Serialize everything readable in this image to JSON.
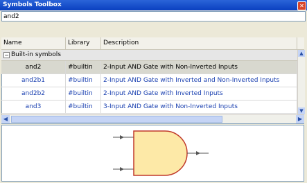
{
  "window": {
    "title": "Symbols Toolbox"
  },
  "search": {
    "value": "and2"
  },
  "table": {
    "headers": [
      "Name",
      "Library",
      "Description"
    ],
    "group": {
      "label": "Built-in symbols",
      "toggle": "−"
    },
    "rows": [
      {
        "name": "and2",
        "library": "#builtin",
        "description": "2-Input AND Gate with Non-Inverted Inputs"
      },
      {
        "name": "and2b1",
        "library": "#builtin",
        "description": "2-Input AND Gate with Inverted and Non-Inverted Inputs"
      },
      {
        "name": "and2b2",
        "library": "#builtin",
        "description": "2-Input AND Gate with Inverted Inputs"
      },
      {
        "name": "and3",
        "library": "#builtin",
        "description": "3-Input AND Gate with Non-Inverted Inputs"
      }
    ]
  },
  "preview": {
    "symbol": "and-gate-2-input"
  },
  "colors": {
    "titlebar": "#0a40c0",
    "link_text": "#1a40b0",
    "gate_fill": "#fde9a7",
    "gate_stroke": "#c0392b"
  }
}
